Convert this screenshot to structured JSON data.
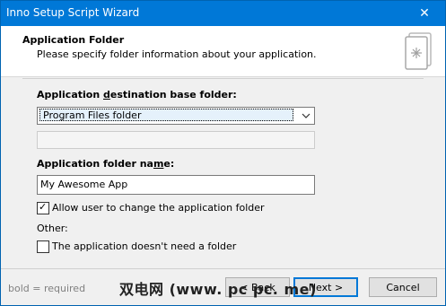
{
  "window": {
    "title": "Inno Setup Script Wizard"
  },
  "header": {
    "title": "Application Folder",
    "subtitle": "Please specify folder information about your application."
  },
  "form": {
    "base_folder_label_pre": "Application ",
    "base_folder_label_u": "d",
    "base_folder_label_post": "estination base folder:",
    "base_folder_selected": "Program Files folder",
    "folder_name_label_pre": "Application folder na",
    "folder_name_label_u": "m",
    "folder_name_label_post": "e:",
    "folder_name_value": "My Awesome App",
    "allow_change_label": "Allow user to change the application folder",
    "allow_change_checked": true,
    "other_label": "Other:",
    "no_folder_label": "The application doesn't need a folder",
    "no_folder_checked": false
  },
  "footer": {
    "hint": "bold = required",
    "back_label": "< Back",
    "next_label": "Next >",
    "cancel_label": "Cancel",
    "watermark": "双电网 (www. pc pc. me)"
  },
  "icons": {
    "close": "close-icon",
    "wizard": "wizard-book-icon",
    "dropdown": "chevron-down-icon",
    "checkmark": "checkmark-icon"
  }
}
